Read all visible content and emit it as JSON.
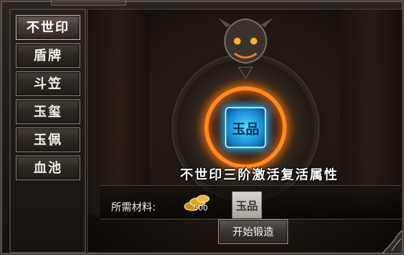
{
  "tabs": [
    {
      "label": "不世印",
      "active": true
    },
    {
      "label": "盾牌",
      "active": false
    },
    {
      "label": "斗笠",
      "active": false
    },
    {
      "label": "玉玺",
      "active": false
    },
    {
      "label": "玉佩",
      "active": false
    },
    {
      "label": "血池",
      "active": false
    }
  ],
  "scene": {
    "title": "不世印三阶激活复活属性",
    "seal_glyph": "玉品",
    "icons": [
      "dragon-head-icon",
      "fire-ring-icon",
      "seal-icon"
    ]
  },
  "materials": {
    "label": "所需材料:",
    "gold_count": "500",
    "seal_glyph": "玉品"
  },
  "actions": {
    "forge_label": "开始锻造"
  },
  "colors": {
    "fire": "#ff8a1e",
    "seal_glow": "#4ee0ff",
    "text": "#ffffff"
  }
}
